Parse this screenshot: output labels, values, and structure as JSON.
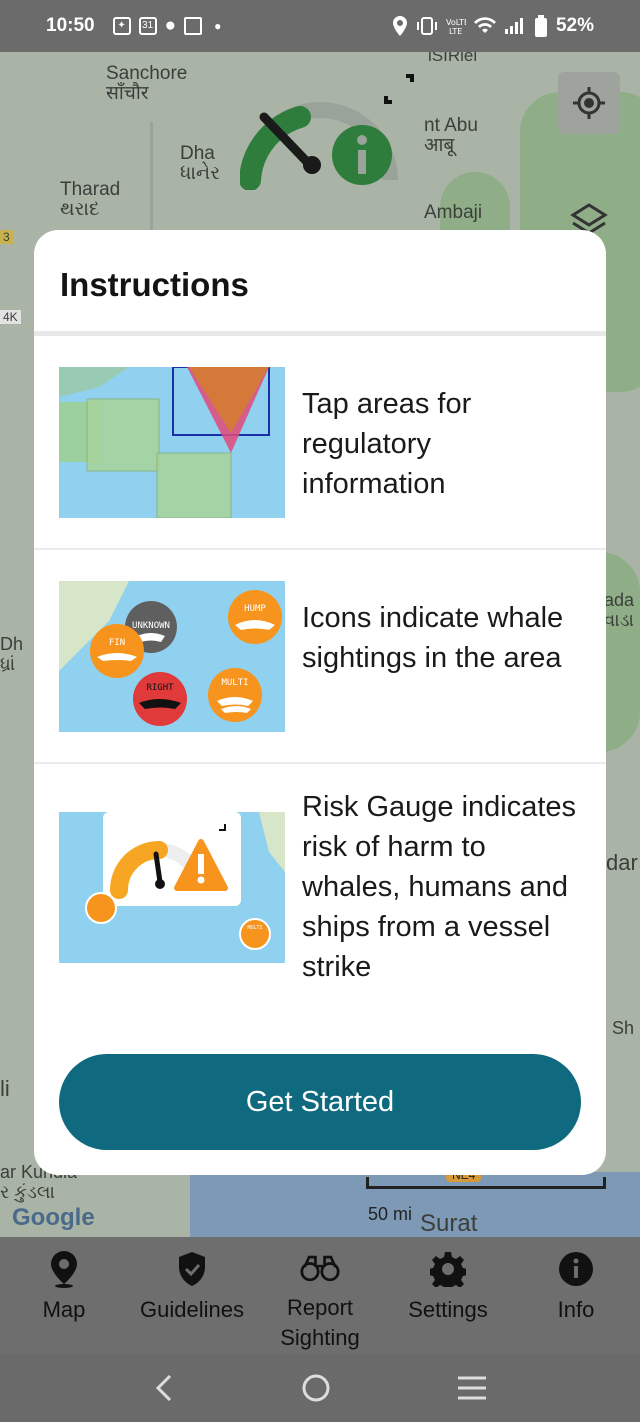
{
  "status_bar": {
    "time": "10:50",
    "battery": "52%",
    "calendar_badge": "31"
  },
  "map": {
    "labels": [
      {
        "text": "Sanchore",
        "sub": "साँचौर"
      },
      {
        "text": "Dha",
        "sub": "ધાનેર"
      },
      {
        "text": "Tharad",
        "sub": "થરાદ"
      },
      {
        "text": "nt Abu",
        "sub": "आबू"
      },
      {
        "text": "Ambaji",
        "sub": ""
      },
      {
        "text": "lSIRlel",
        "sub": ""
      },
      {
        "text": "ada",
        "sub": "વાડા"
      },
      {
        "text": "Dh",
        "sub": "ધ્રાં"
      },
      {
        "text": "dar",
        "sub": ""
      },
      {
        "text": "Sh",
        "sub": ""
      },
      {
        "text": "li",
        "sub": ""
      },
      {
        "text": "ar Kundla",
        "sub": "ર કુંડલા"
      },
      {
        "text": "Surat",
        "sub": ""
      },
      {
        "text": "3",
        "sub": ""
      },
      {
        "text": "4K",
        "sub": ""
      }
    ],
    "scale_label": "50 mi",
    "highway": "NE4",
    "google": "Google"
  },
  "modal": {
    "title": "Instructions",
    "items": [
      {
        "text": "Tap areas for regulatory information",
        "thumb": "regulatory-areas"
      },
      {
        "text": "Icons indicate whale sightings in the area",
        "thumb": "whale-icons",
        "icon_labels": [
          "UNKNOWN",
          "FIN",
          "HUMP",
          "RIGHT",
          "MULTI"
        ]
      },
      {
        "text": "Risk Gauge indicates risk of harm to whales, humans and ships from a vessel strike",
        "thumb": "risk-gauge",
        "icon_labels": [
          "MULTI"
        ]
      }
    ],
    "cta": "Get Started"
  },
  "bottom_nav": [
    {
      "label": "Map",
      "icon": "map-pin-icon"
    },
    {
      "label": "Guidelines",
      "icon": "shield-check-icon"
    },
    {
      "label": "Report Sighting",
      "icon": "binoculars-icon"
    },
    {
      "label": "Settings",
      "icon": "gear-icon"
    },
    {
      "label": "Info",
      "icon": "info-icon"
    }
  ],
  "colors": {
    "accent": "#0f6a7f",
    "gauge_orange": "#f7941d",
    "gauge_red": "#e03a3a",
    "whale_orange": "#f7941d"
  }
}
